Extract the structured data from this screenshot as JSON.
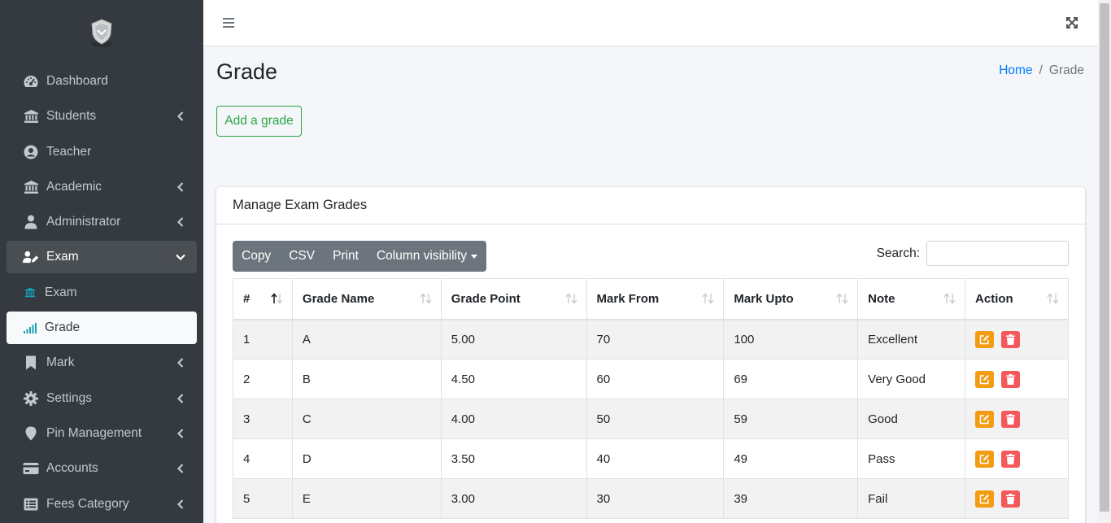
{
  "sidebar": {
    "items": [
      {
        "label": "Dashboard"
      },
      {
        "label": "Students"
      },
      {
        "label": "Teacher"
      },
      {
        "label": "Academic"
      },
      {
        "label": "Administrator"
      },
      {
        "label": "Exam"
      },
      {
        "label": "Exam"
      },
      {
        "label": "Grade"
      },
      {
        "label": "Mark"
      },
      {
        "label": "Settings"
      },
      {
        "label": "Pin Management"
      },
      {
        "label": "Accounts"
      },
      {
        "label": "Fees Category"
      }
    ]
  },
  "page": {
    "title": "Grade",
    "add_button": "Add a grade"
  },
  "breadcrumb": {
    "home": "Home",
    "separator": "/",
    "current": "Grade"
  },
  "card": {
    "title": "Manage Exam Grades",
    "buttons": [
      "Copy",
      "CSV",
      "Print",
      "Column visibility"
    ],
    "search_label": "Search:"
  },
  "table": {
    "headers": [
      "#",
      "Grade Name",
      "Grade Point",
      "Mark From",
      "Mark Upto",
      "Note",
      "Action"
    ],
    "rows": [
      [
        "1",
        "A",
        "5.00",
        "70",
        "100",
        "Excellent"
      ],
      [
        "2",
        "B",
        "4.50",
        "60",
        "69",
        "Very Good"
      ],
      [
        "3",
        "C",
        "4.00",
        "50",
        "59",
        "Good"
      ],
      [
        "4",
        "D",
        "3.50",
        "40",
        "49",
        "Pass"
      ],
      [
        "5",
        "E",
        "3.00",
        "30",
        "39",
        "Fail"
      ]
    ]
  },
  "colors": {
    "sidebar_bg": "#343a40",
    "success": "#28a745",
    "primary": "#007bff",
    "edit": "#f39c12",
    "delete": "#f5585a"
  }
}
